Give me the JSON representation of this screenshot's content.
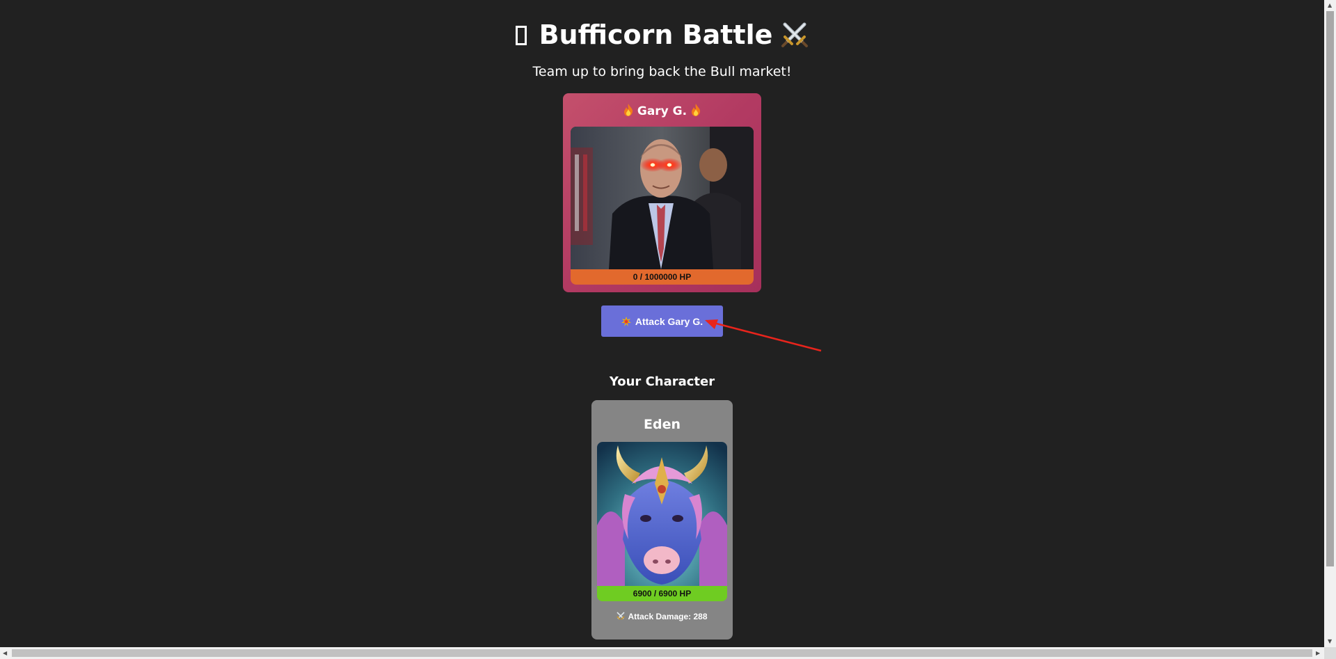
{
  "header": {
    "title": "Bufficorn Battle",
    "subtitle": "Team up to bring back the Bull market!"
  },
  "boss": {
    "name": "Gary G.",
    "hp_text": "0 / 1000000 HP",
    "hp_current": 0,
    "hp_max": 1000000,
    "bar_color": "#e2692d",
    "card_color": "#b23a62"
  },
  "attack": {
    "label": "Attack Gary G.",
    "button_color": "#6a6fd9"
  },
  "your_character": {
    "heading": "Your Character",
    "name": "Eden",
    "hp_text": "6900 / 6900 HP",
    "hp_current": 6900,
    "hp_max": 6900,
    "bar_color": "#6fcc22",
    "attack_damage_label": "Attack Damage: 288"
  },
  "icons": {
    "title_left": "missing-glyph-icon",
    "title_right": "crossed-swords-icon",
    "boss_name_flank": "fire-icon",
    "attack_button": "collision-icon",
    "damage": "crossed-swords-icon"
  }
}
